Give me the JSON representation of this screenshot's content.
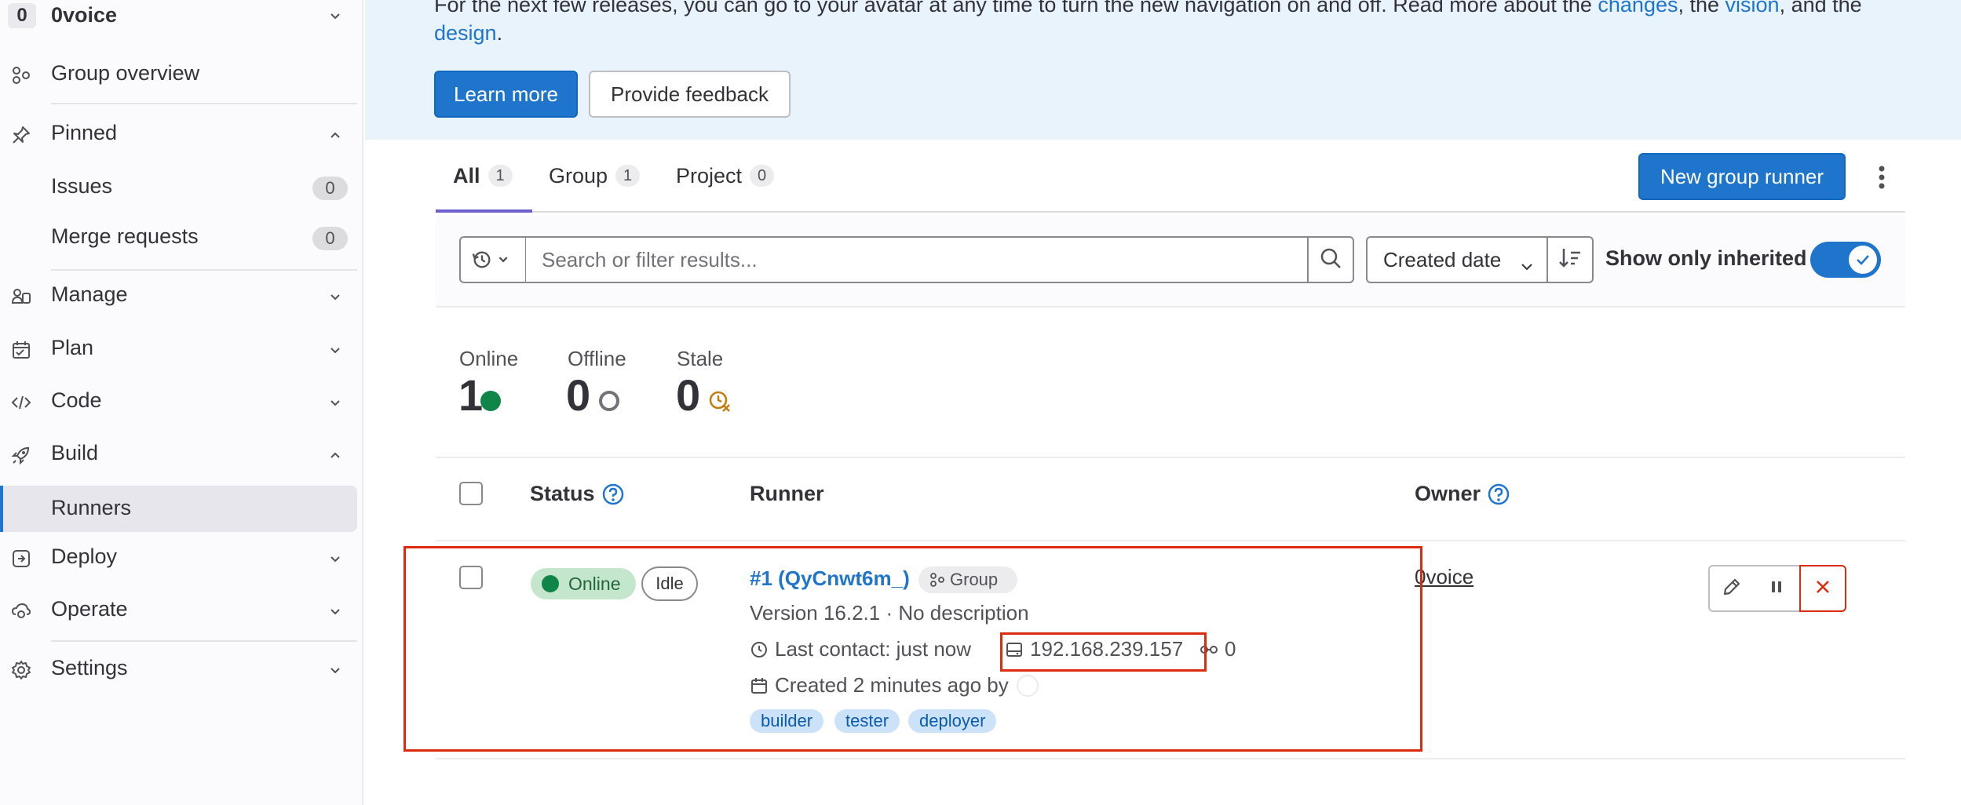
{
  "sidebar": {
    "group_avatar": "0",
    "group_name": "0voice",
    "items": {
      "overview": "Group overview",
      "pinned": "Pinned",
      "issues": "Issues",
      "issues_count": "0",
      "merge_requests": "Merge requests",
      "merge_requests_count": "0",
      "manage": "Manage",
      "plan": "Plan",
      "code": "Code",
      "build": "Build",
      "runners": "Runners",
      "deploy": "Deploy",
      "operate": "Operate",
      "settings": "Settings"
    }
  },
  "banner": {
    "line1_prefix": "For the next few releases, you can go to your avatar at any time to turn the new navigation on and off. Read more about the ",
    "link_changes": "changes",
    "sep1": ", the ",
    "link_vision": "vision",
    "sep2": ", and the",
    "link_design": "design",
    "period": ".",
    "learn_more": "Learn more",
    "provide_feedback": "Provide feedback"
  },
  "tabs": {
    "all": "All",
    "all_count": "1",
    "group": "Group",
    "group_count": "1",
    "project": "Project",
    "project_count": "0",
    "new_runner": "New group runner"
  },
  "filter": {
    "search_placeholder": "Search or filter results...",
    "sort_label": "Created date",
    "toggle_label": "Show only inherited"
  },
  "stats": {
    "online_label": "Online",
    "online_value": "1",
    "offline_label": "Offline",
    "offline_value": "0",
    "stale_label": "Stale",
    "stale_value": "0"
  },
  "table": {
    "headers": {
      "status": "Status",
      "runner": "Runner",
      "owner": "Owner"
    },
    "row": {
      "status": "Online",
      "idle": "Idle",
      "runner_name": "#1 (QyCnwt6m_)",
      "runner_type": "Group",
      "version": "Version 16.2.1 · No description",
      "last_contact": "Last contact: just now",
      "ip": "192.168.239.157",
      "jobs": "0",
      "created": "Created 2 minutes ago by",
      "tags": [
        "builder",
        "tester",
        "deployer"
      ],
      "owner": "0voice"
    }
  },
  "colors": {
    "accent": "#1f75cb",
    "online": "#108548",
    "highlight": "#dd2b0e",
    "stale": "#c17d10"
  }
}
